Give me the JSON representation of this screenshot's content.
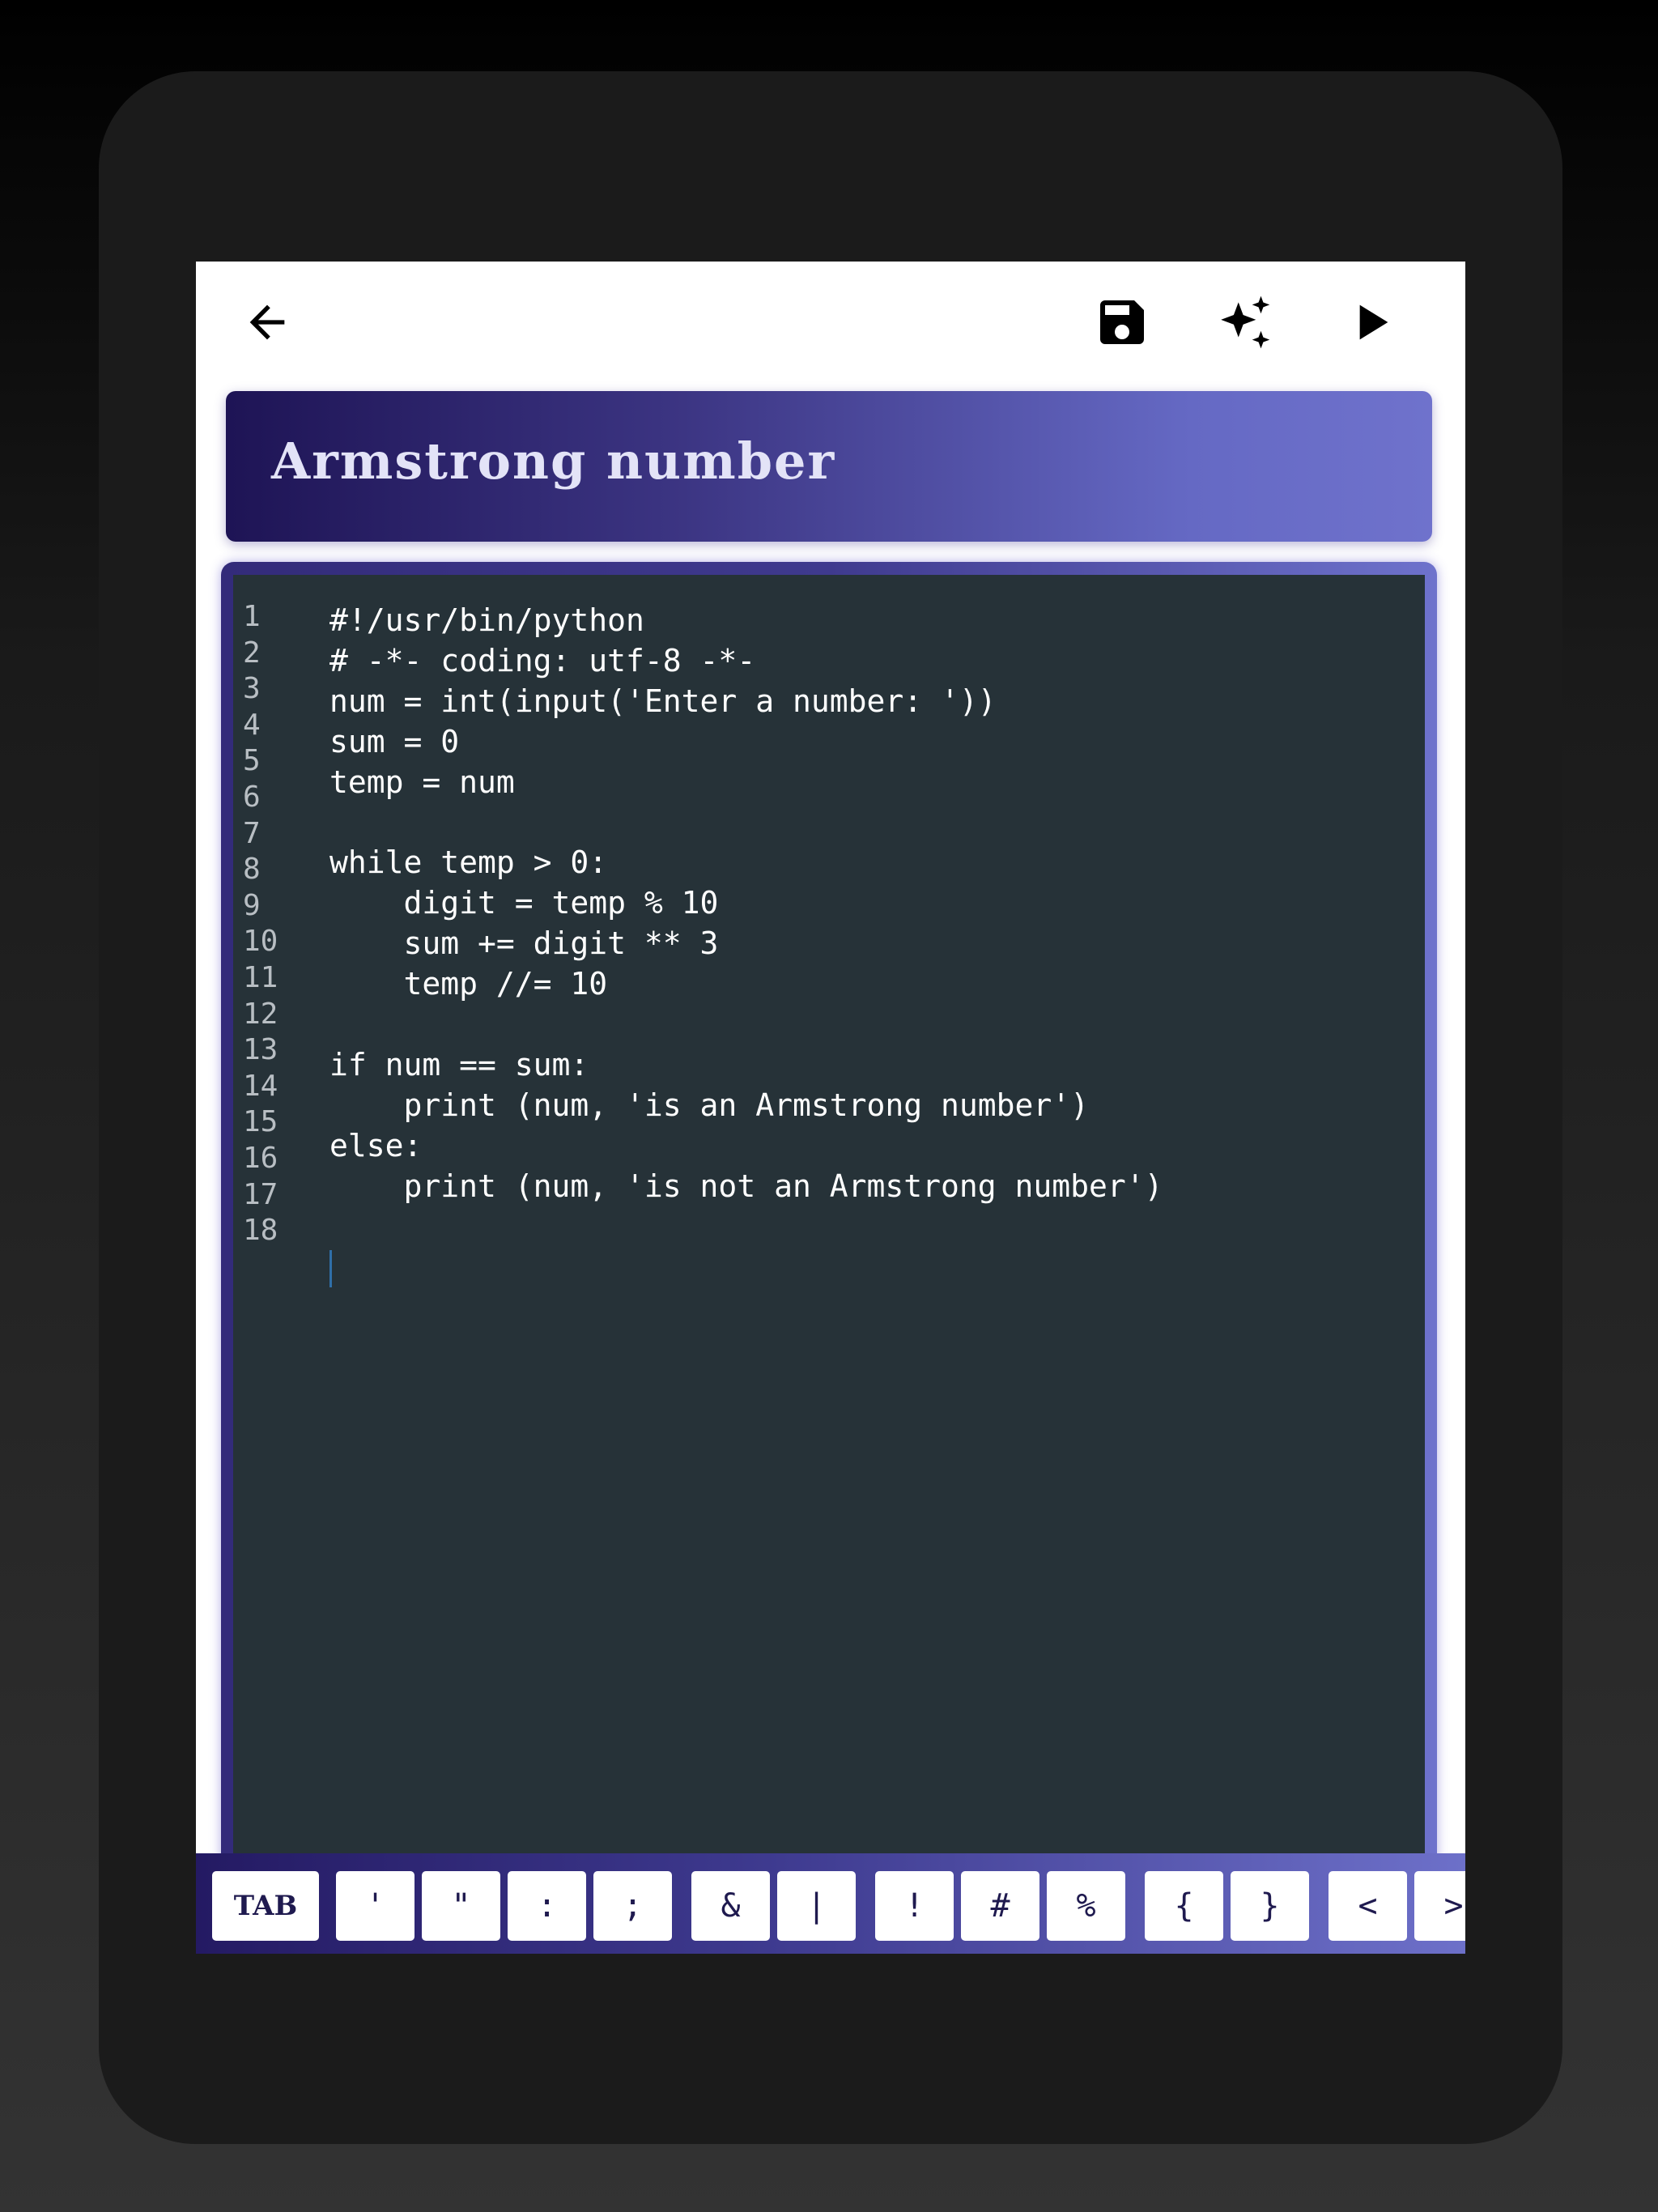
{
  "header": {
    "back_icon": "arrow-left-icon",
    "save_icon": "floppy-disk-icon",
    "ai_icon": "sparkles-icon",
    "run_icon": "play-icon"
  },
  "title": "Armstrong number",
  "editor": {
    "line_numbers": [
      "1",
      "2",
      "3",
      "4",
      "5",
      "6",
      "7",
      "8",
      "9",
      "10",
      "11",
      "12",
      "13",
      "14",
      "15",
      "16",
      "17",
      "18"
    ],
    "lines": [
      "#!/usr/bin/python",
      "# -*- coding: utf-8 -*-",
      "num = int(input('Enter a number: '))",
      "sum = 0",
      "temp = num",
      "",
      "while temp > 0:",
      "    digit = temp % 10",
      "    sum += digit ** 3",
      "    temp //= 10",
      "",
      "if num == sum:",
      "    print (num, 'is an Armstrong number')",
      "else:",
      "    print (num, 'is not an Armstrong number')",
      ""
    ]
  },
  "keys": [
    "TAB",
    "'",
    "\"",
    ":",
    ";",
    "&",
    "|",
    "!",
    "#",
    "%",
    "{",
    "}",
    "<",
    ">"
  ],
  "colors": {
    "editor_bg": "#263238",
    "accent_dark": "#1e1455",
    "accent_light": "#6f72cc"
  }
}
